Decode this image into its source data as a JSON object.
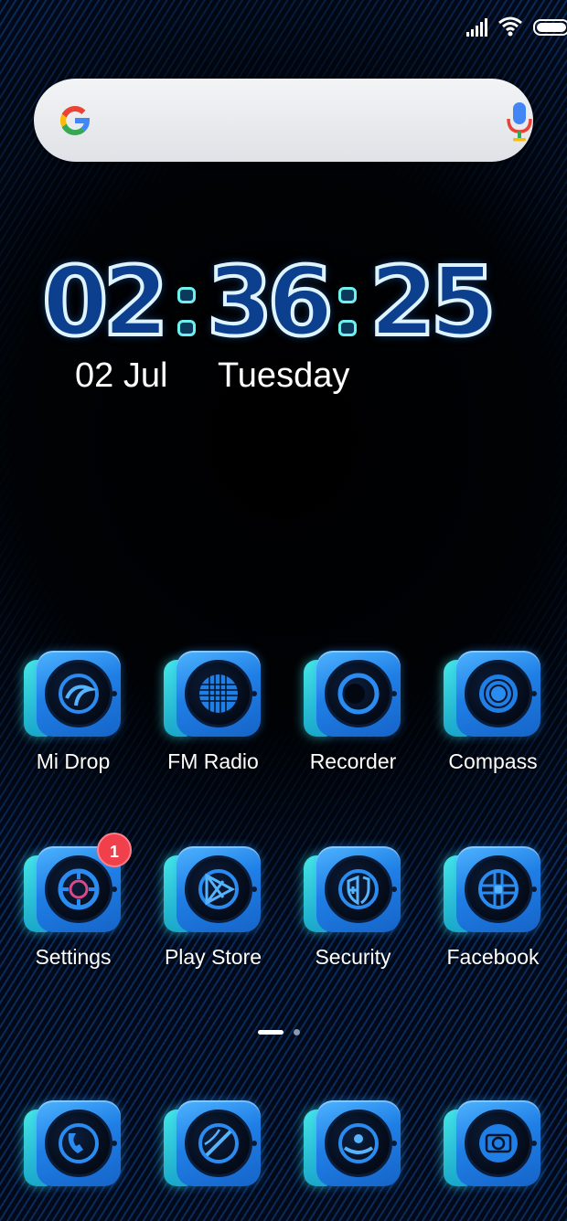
{
  "status_bar": {
    "signal": "signal-icon",
    "wifi": "wifi-icon",
    "battery": "battery-icon"
  },
  "search": {
    "logo": "google-logo",
    "mic": "mic-icon"
  },
  "clock": {
    "hours": "02",
    "minutes": "36",
    "seconds": "25",
    "date": "02 Jul",
    "day": "Tuesday"
  },
  "apps_row1": [
    {
      "label": "Mi Drop"
    },
    {
      "label": "FM Radio"
    },
    {
      "label": "Recorder"
    },
    {
      "label": "Compass"
    }
  ],
  "apps_row2": [
    {
      "label": "Settings",
      "badge": "1"
    },
    {
      "label": "Play Store"
    },
    {
      "label": "Security"
    },
    {
      "label": "Facebook"
    }
  ],
  "dock": [
    {
      "icon": "phone-icon"
    },
    {
      "icon": "browser-icon"
    },
    {
      "icon": "messages-icon"
    },
    {
      "icon": "camera-icon"
    }
  ],
  "page_indicator": {
    "pages": 2,
    "current": 1
  },
  "colors": {
    "icon_face": "#2a8cf0",
    "icon_side": "#3ad6e0",
    "badge": "#f0404c"
  }
}
